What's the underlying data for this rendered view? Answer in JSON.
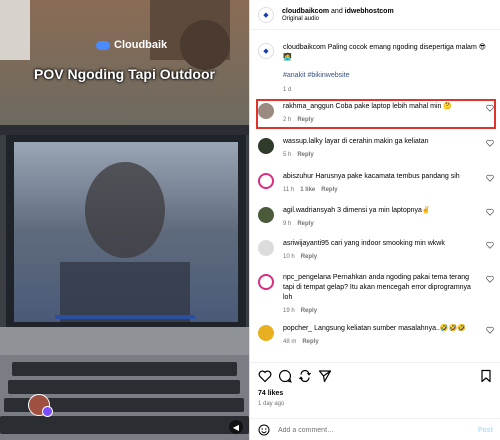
{
  "media": {
    "brand": "Cloudbaik",
    "overlay_title": "POV Ngoding Tapi Outdoor"
  },
  "header": {
    "user1": "cloudbaikcom",
    "and": "and",
    "user2": "idwebhostcom",
    "audio": "Original audio"
  },
  "caption": {
    "text": "cloudbaikcom Paling cocok emang ngoding disepertiga malam 😎🧑‍💻",
    "hashtags": "#anakit #bikinwebsite",
    "time": "1 d"
  },
  "comments": [
    {
      "user": "rakhma_anggun",
      "text": "Coba pake laptop lebih mahal min 🤔",
      "time": "2 h",
      "likes": "",
      "reply": "Reply"
    },
    {
      "user": "wassup.lalky",
      "text": "layar di cerahin makin ga keliatan",
      "time": "5 h",
      "likes": "",
      "reply": "Reply"
    },
    {
      "user": "abiszuhur",
      "text": "Harusnya pake kacamata tembus pandang sih",
      "time": "11 h",
      "likes": "1 like",
      "reply": "Reply"
    },
    {
      "user": "agil.wadriansyah",
      "text": "3 dimensi ya min laptopnya✌️",
      "time": "9 h",
      "likes": "",
      "reply": "Reply"
    },
    {
      "user": "asriwijayanti95",
      "text": "cari yang indoor smooking min wkwk",
      "time": "10 h",
      "likes": "",
      "reply": "Reply"
    },
    {
      "user": "npc_pengelana",
      "text": "Pernahkan anda ngoding pakai tema terang tapi di tempat gelap? Itu akan mencegah error diprogramnya loh",
      "time": "19 h",
      "likes": "",
      "reply": "Reply"
    },
    {
      "user": "popcher_",
      "text": "Langsung keliatan sumber masalahnya..🤣🤣🤣",
      "time": "48 m",
      "likes": "",
      "reply": "Reply"
    }
  ],
  "actions": {
    "likes": "74 likes",
    "ago": "1 day ago",
    "placeholder": "Add a comment…",
    "post": "Post"
  },
  "colors": {
    "link": "#385185",
    "highlight": "#e0342b",
    "post_disabled": "#b2dffc"
  }
}
